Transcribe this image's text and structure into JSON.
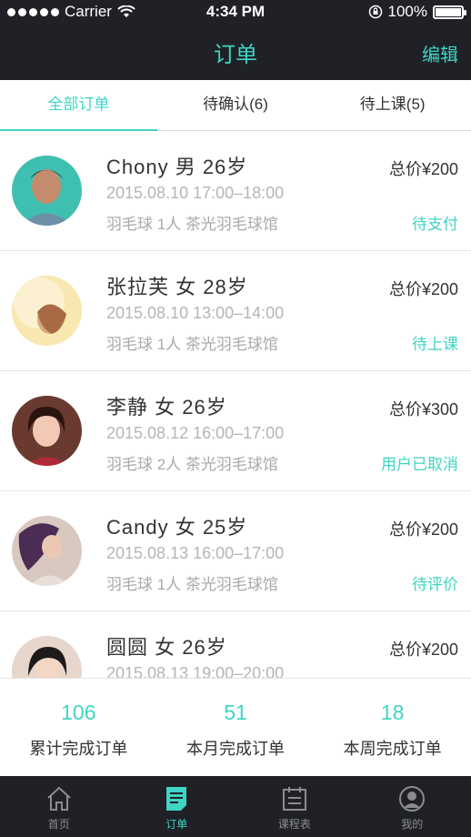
{
  "status_bar": {
    "carrier": "Carrier",
    "time": "4:34 PM",
    "battery": "100%"
  },
  "nav": {
    "title": "订单",
    "edit": "编辑"
  },
  "tabs": [
    {
      "label": "全部订单",
      "active": true
    },
    {
      "label": "待确认(6)",
      "active": false
    },
    {
      "label": "待上课(5)",
      "active": false
    }
  ],
  "orders": [
    {
      "name": "Chony  男  26岁",
      "datetime": "2015.08.10 17:00–18:00",
      "detail": "羽毛球 1人 茶光羽毛球馆",
      "price": "总价¥200",
      "status": "待支付",
      "avatar_color": "#3fbfb0"
    },
    {
      "name": "张拉芙  女  28岁",
      "datetime": "2015.08.10 13:00–14:00",
      "detail": "羽毛球 1人 茶光羽毛球馆",
      "price": "总价¥200",
      "status": "待上课",
      "avatar_color": "#f5d98a"
    },
    {
      "name": "李静  女  26岁",
      "datetime": "2015.08.12 16:00–17:00",
      "detail": "羽毛球 2人 茶光羽毛球馆",
      "price": "总价¥300",
      "status": "用户已取消",
      "avatar_color": "#8a5a4a"
    },
    {
      "name": "Candy  女  25岁",
      "datetime": "2015.08.13 16:00–17:00",
      "detail": "羽毛球 1人 茶光羽毛球馆",
      "price": "总价¥200",
      "status": "待评价",
      "avatar_color": "#9a7aa8"
    },
    {
      "name": "圆圆  女  26岁",
      "datetime": "2015.08.13 19:00–20:00",
      "detail": "",
      "price": "总价¥200",
      "status": "",
      "avatar_color": "#c9a89a"
    }
  ],
  "stats": [
    {
      "value": "106",
      "label": "累计完成订单"
    },
    {
      "value": "51",
      "label": "本月完成订单"
    },
    {
      "value": "18",
      "label": "本周完成订单"
    }
  ],
  "tabbar": [
    {
      "label": "首页",
      "icon": "home-icon",
      "active": false
    },
    {
      "label": "订单",
      "icon": "order-icon",
      "active": true
    },
    {
      "label": "课程表",
      "icon": "calendar-icon",
      "active": false
    },
    {
      "label": "我的",
      "icon": "profile-icon",
      "active": false
    }
  ],
  "colors": {
    "accent": "#3fd5c4",
    "dark_bar": "#1f2126"
  }
}
